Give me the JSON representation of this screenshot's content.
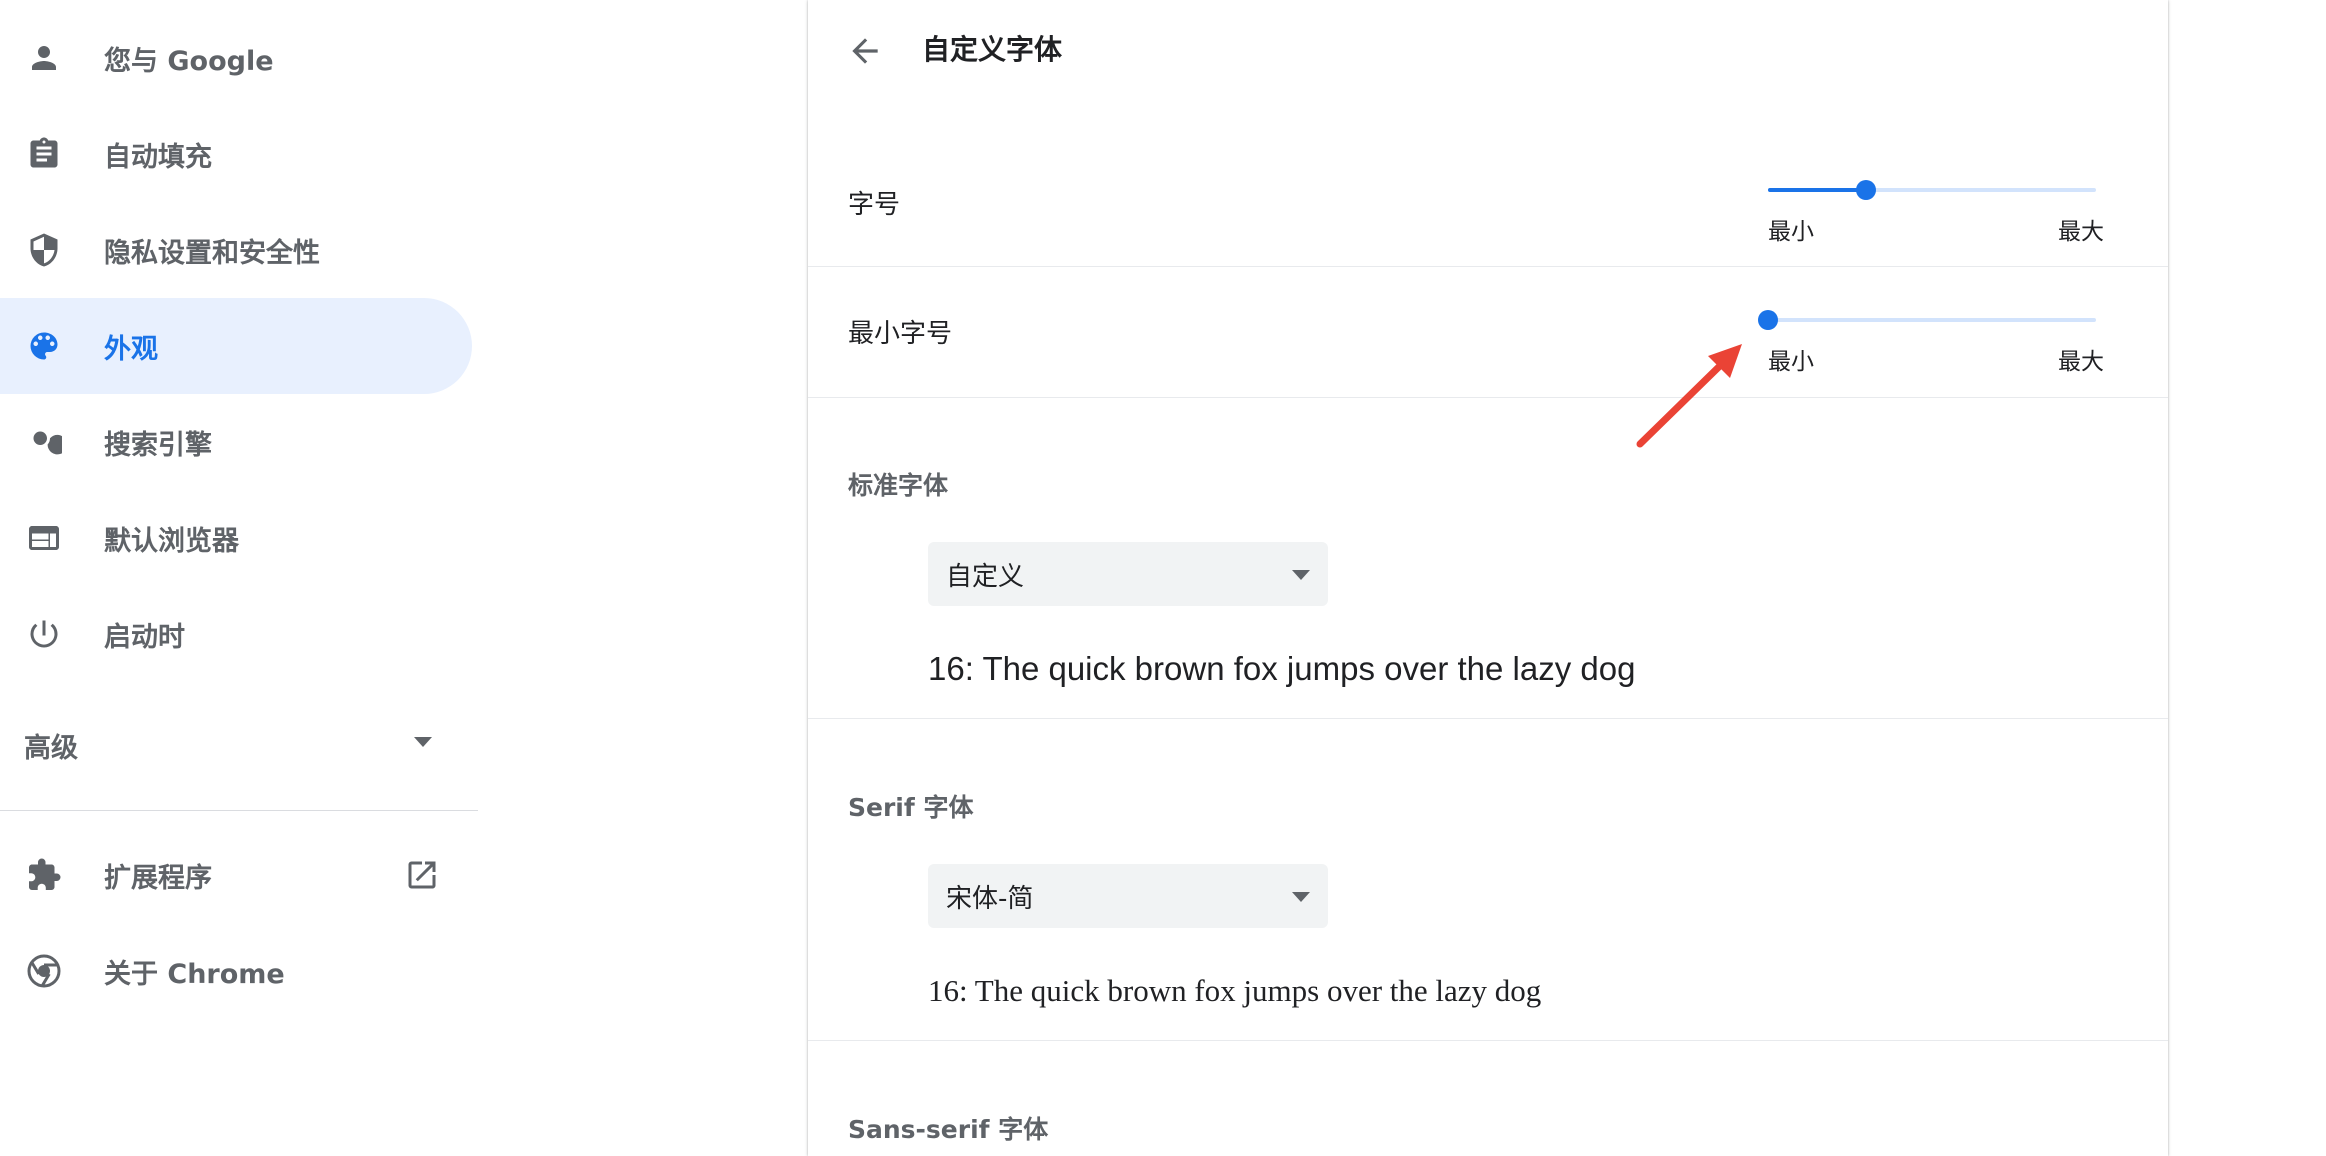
{
  "sidebar": {
    "items": [
      {
        "label": "您与 Google",
        "icon": "person-icon",
        "active": false
      },
      {
        "label": "自动填充",
        "icon": "clipboard-icon",
        "active": false
      },
      {
        "label": "隐私设置和安全性",
        "icon": "shield-icon",
        "active": false
      },
      {
        "label": "外观",
        "icon": "palette-icon",
        "active": true
      },
      {
        "label": "搜索引擎",
        "icon": "search-icon",
        "active": false
      },
      {
        "label": "默认浏览器",
        "icon": "browser-window-icon",
        "active": false
      },
      {
        "label": "启动时",
        "icon": "power-icon",
        "active": false
      }
    ],
    "advanced_label": "高级",
    "extensions_label": "扩展程序",
    "about_label": "关于 Chrome"
  },
  "page": {
    "title": "自定义字体",
    "font_size": {
      "label": "字号",
      "min_label": "最小",
      "max_label": "最大",
      "value_fraction": 0.3
    },
    "min_font_size": {
      "label": "最小字号",
      "min_label": "最小",
      "max_label": "最大",
      "value_fraction": 0.0
    },
    "standard_font": {
      "label": "标准字体",
      "selected": "自定义",
      "sample": "16: The quick brown fox jumps over the lazy dog"
    },
    "serif_font": {
      "label": "Serif 字体",
      "selected": "宋体-简",
      "sample": "16: The quick brown fox jumps over the lazy dog"
    },
    "sans_serif_font": {
      "label": "Sans-serif 字体"
    }
  },
  "colors": {
    "accent": "#1a73e8",
    "active_bg": "#e8f0fe",
    "annotation_arrow": "#ea4335"
  }
}
